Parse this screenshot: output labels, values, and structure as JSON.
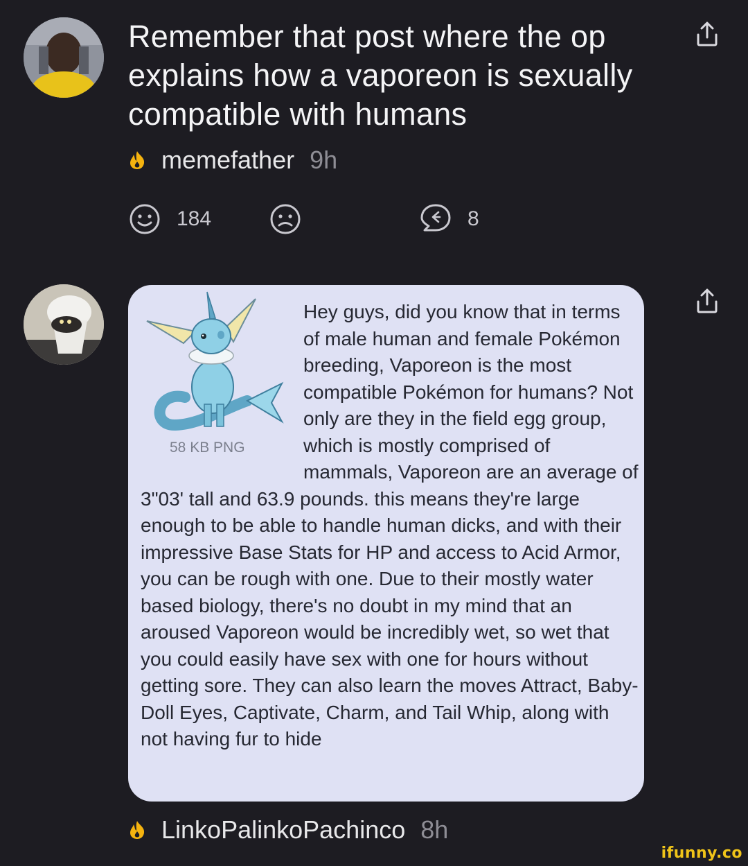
{
  "post": {
    "title": "Remember that post where the op explains how a vaporeon is sexually compatible with humans",
    "username": "memefather",
    "time": "9h",
    "smile_count": "184",
    "reply_count": "8",
    "icons": [
      "avatar",
      "fire-icon",
      "share-icon",
      "smile-icon",
      "frown-icon",
      "reply-icon"
    ]
  },
  "comment": {
    "attachment_size": "58 KB PNG",
    "text": "Hey guys, did you know that in terms of male human and female Pokémon breeding, Vaporeon is the most compatible Pokémon for humans? Not only are they in the field egg group, which is mostly comprised of mammals, Vaporeon are an average of 3\"03' tall and 63.9 pounds. this means they're large enough to be able to handle human dicks, and with their impressive Base Stats for HP and access to Acid Armor, you can be rough with one. Due to their mostly water based biology, there's no doubt in my mind that an aroused Vaporeon would be incredibly wet, so wet that you could easily have sex with one for hours without getting sore. They can also learn the moves Attract, Baby-Doll Eyes, Captivate, Charm, and Tail Whip, along with not having fur to hide",
    "username": "LinkoPalinkoPachinco",
    "time": "8h",
    "card_color": "#dfe1f4"
  },
  "watermark": "ifunny.co",
  "colors": {
    "background": "#1d1c22",
    "fire": "#f5b30f",
    "muted": "#8e8d95",
    "watermark": "#f0c419"
  }
}
